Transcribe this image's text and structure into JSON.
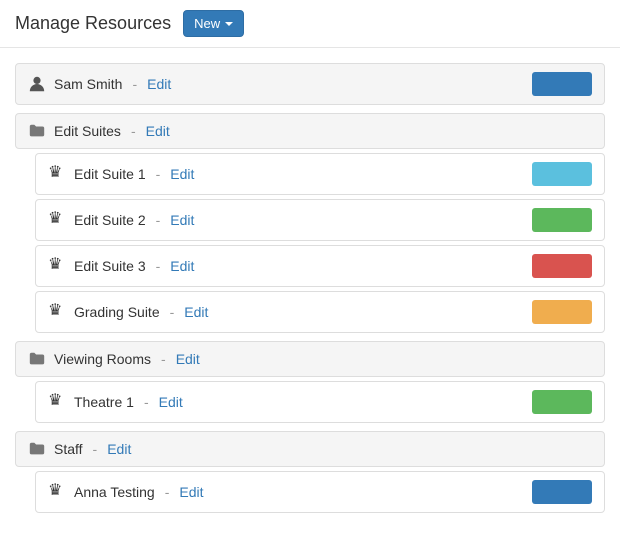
{
  "header": {
    "title": "Manage Resources",
    "new_button_label": "New",
    "new_button_caret": true
  },
  "resources": {
    "top_person": {
      "name": "Sam Smith",
      "separator": " - ",
      "edit_label": "Edit",
      "color": "#337ab7"
    },
    "groups": [
      {
        "id": "edit-suites",
        "name": "Edit Suites",
        "separator": " - ",
        "edit_label": "Edit",
        "items": [
          {
            "name": "Edit Suite 1",
            "separator": " - ",
            "edit_label": "Edit",
            "color": "#5bc0de"
          },
          {
            "name": "Edit Suite 2",
            "separator": " - ",
            "edit_label": "Edit",
            "color": "#5cb85c"
          },
          {
            "name": "Edit Suite 3",
            "separator": " - ",
            "edit_label": "Edit",
            "color": "#d9534f"
          },
          {
            "name": "Grading Suite",
            "separator": " - ",
            "edit_label": "Edit",
            "color": "#f0ad4e"
          }
        ]
      },
      {
        "id": "viewing-rooms",
        "name": "Viewing Rooms",
        "separator": " - ",
        "edit_label": "Edit",
        "items": [
          {
            "name": "Theatre 1",
            "separator": " - ",
            "edit_label": "Edit",
            "color": "#5cb85c"
          }
        ]
      },
      {
        "id": "staff",
        "name": "Staff",
        "separator": " - ",
        "edit_label": "Edit",
        "items": [
          {
            "name": "Anna Testing",
            "separator": " - ",
            "edit_label": "Edit",
            "color": "#337ab7"
          }
        ]
      }
    ]
  }
}
